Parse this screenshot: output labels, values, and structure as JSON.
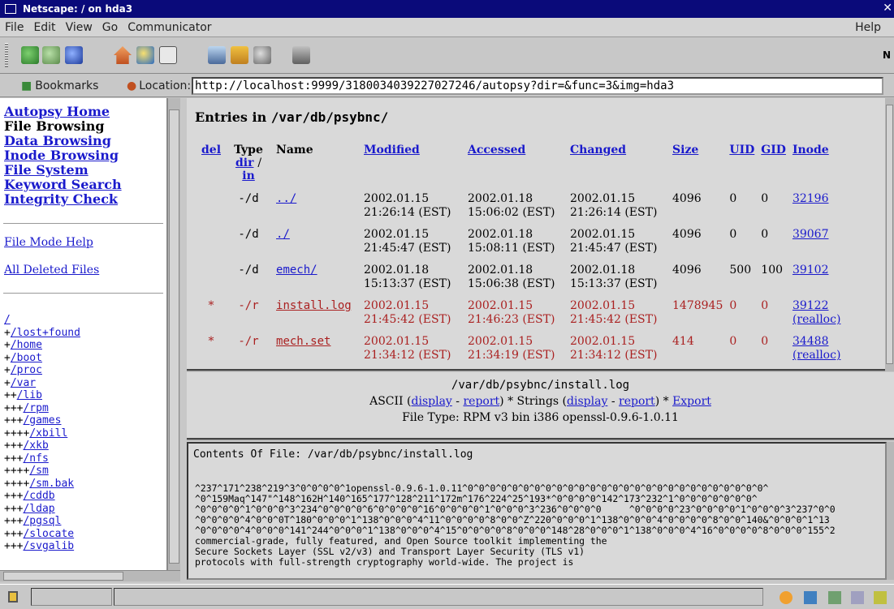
{
  "window": {
    "title": "Netscape: / on hda3",
    "close_glyph": "✕"
  },
  "menu": [
    "File",
    "Edit",
    "View",
    "Go",
    "Communicator"
  ],
  "menu_help": "Help",
  "toolbar": {
    "brand_glyph": "N"
  },
  "location": {
    "bookmarks_label": "Bookmarks",
    "location_label": "Location:",
    "url": "http://localhost:9999/3180034039227027246/autopsy?dir=&func=3&img=hda3"
  },
  "nav": {
    "home": "Autopsy Home",
    "current": "File Browsing",
    "data": "Data Browsing",
    "inode": "Inode Browsing",
    "fs": "File System",
    "keyword": "Keyword Search",
    "integrity": "Integrity Check",
    "help": "File Mode Help",
    "deleted": "All Deleted Files"
  },
  "tree": [
    {
      "prefix": "",
      "name": "/"
    },
    {
      "prefix": "+",
      "name": "/lost+found"
    },
    {
      "prefix": "+",
      "name": "/home"
    },
    {
      "prefix": "+",
      "name": "/boot"
    },
    {
      "prefix": "+",
      "name": "/proc"
    },
    {
      "prefix": "+",
      "name": "/var"
    },
    {
      "prefix": "++",
      "name": "/lib"
    },
    {
      "prefix": "+++",
      "name": "/rpm"
    },
    {
      "prefix": "+++",
      "name": "/games"
    },
    {
      "prefix": "++++",
      "name": "/xbill"
    },
    {
      "prefix": "+++",
      "name": "/xkb"
    },
    {
      "prefix": "+++",
      "name": "/nfs"
    },
    {
      "prefix": "++++",
      "name": "/sm"
    },
    {
      "prefix": "++++",
      "name": "/sm.bak"
    },
    {
      "prefix": "+++",
      "name": "/cddb"
    },
    {
      "prefix": "+++",
      "name": "/ldap"
    },
    {
      "prefix": "+++",
      "name": "/pgsql"
    },
    {
      "prefix": "+++",
      "name": "/slocate"
    },
    {
      "prefix": "+++",
      "name": "/svgalib"
    }
  ],
  "listing": {
    "heading_prefix": "Entries in",
    "heading_path": "/var/db/psybnc/",
    "headers": {
      "del": "del",
      "type": "Type",
      "dir": "dir",
      "slash": "/",
      "in": "in",
      "name": "Name",
      "modified": "Modified",
      "accessed": "Accessed",
      "changed": "Changed",
      "size": "Size",
      "uid": "UID",
      "gid": "GID",
      "inode": "Inode"
    },
    "rows": [
      {
        "del": "",
        "type": "-/d",
        "name": "../",
        "m1": "2002.01.15",
        "m2": "21:26:14 (EST)",
        "a1": "2002.01.18",
        "a2": "15:06:02 (EST)",
        "c1": "2002.01.15",
        "c2": "21:26:14 (EST)",
        "size": "4096",
        "uid": "0",
        "gid": "0",
        "inode": "32196",
        "extra": ""
      },
      {
        "del": "",
        "type": "-/d",
        "name": "./",
        "m1": "2002.01.15",
        "m2": "21:45:47 (EST)",
        "a1": "2002.01.18",
        "a2": "15:08:11 (EST)",
        "c1": "2002.01.15",
        "c2": "21:45:47 (EST)",
        "size": "4096",
        "uid": "0",
        "gid": "0",
        "inode": "39067",
        "extra": ""
      },
      {
        "del": "",
        "type": "-/d",
        "name": "emech/",
        "m1": "2002.01.18",
        "m2": "15:13:37 (EST)",
        "a1": "2002.01.18",
        "a2": "15:06:38 (EST)",
        "c1": "2002.01.18",
        "c2": "15:13:37 (EST)",
        "size": "4096",
        "uid": "500",
        "gid": "100",
        "inode": "39102",
        "extra": ""
      },
      {
        "del": "*",
        "type": "-/r",
        "name": "install.log",
        "m1": "2002.01.15",
        "m2": "21:45:42 (EST)",
        "a1": "2002.01.15",
        "a2": "21:46:23 (EST)",
        "c1": "2002.01.15",
        "c2": "21:45:42 (EST)",
        "size": "1478945",
        "uid": "0",
        "gid": "0",
        "inode": "39122",
        "extra": "(realloc)"
      },
      {
        "del": "*",
        "type": "-/r",
        "name": "mech.set",
        "m1": "2002.01.15",
        "m2": "21:34:12 (EST)",
        "a1": "2002.01.15",
        "a2": "21:34:19 (EST)",
        "c1": "2002.01.15",
        "c2": "21:34:12 (EST)",
        "size": "414",
        "uid": "0",
        "gid": "0",
        "inode": "34488",
        "extra": "(realloc)"
      }
    ]
  },
  "fileinfo": {
    "path": "/var/db/psybnc/install.log",
    "ascii": "ASCII",
    "strings": "Strings",
    "display": "display",
    "report": "report",
    "dash": "-",
    "star": "*",
    "export": "Export",
    "filetype": "File Type: RPM v3 bin i386 openssl-0.9.6-1.0.11"
  },
  "contents": {
    "title": "Contents Of File: /var/db/psybnc/install.log",
    "lines": [
      "^237^171^238^219^3^0^0^0^0^1openssl-0.9.6-1.0.11^0^0^0^0^0^0^0^0^0^0^0^0^0^0^0^0^0^0^0^0^0^0^0^0^0^0^0^",
      "^0^159Maq^147\"^148^162H^140^165^177^128^211^172m^176^224^25^193*^0^0^0^0^142^173^232^1^0^0^0^0^0^0^0^",
      "^0^0^0^0^1^0^0^0^3^234^0^0^0^0^6^0^0^0^0^16^0^0^0^0^1^0^0^0^3^236^0^0^0^0     ^0^0^0^0^23^0^0^0^0^1^0^0^0^3^237^0^0",
      "^0^0^0^0^4^0^0^0T^180^0^0^0^1^138^0^0^0^4^11^0^0^0^0^8^0^0^Z^220^0^0^0^1^138^0^0^0^4^0^0^0^0^8^0^0^140&^0^0^0^1^13",
      "^0^0^0^0^4^0^0^0^141^244^0^0^0^1^138^0^0^0^4^15^0^0^0^0^8^0^0^0^148^28^0^0^0^1^138^0^0^0^4^16^0^0^0^0^8^0^0^0^155^2",
      "commercial-grade, fully featured, and Open Source toolkit implementing the",
      "Secure Sockets Layer (SSL v2/v3) and Transport Layer Security (TLS v1)",
      "protocols with full-strength cryptography world-wide. The project is"
    ]
  }
}
